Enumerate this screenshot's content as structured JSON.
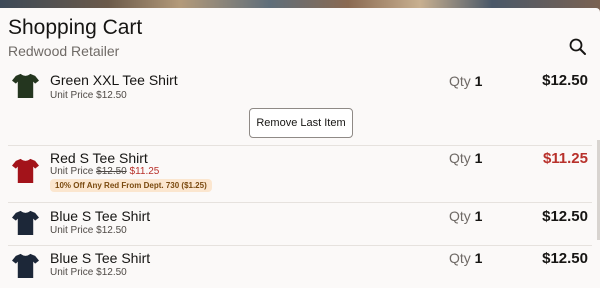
{
  "header": {
    "title": "Shopping Cart",
    "subtitle": "Redwood Retailer"
  },
  "icons": {
    "search": "search-icon",
    "product": "tshirt-icon"
  },
  "actions": {
    "remove_last_item": "Remove Last Item"
  },
  "items": [
    {
      "name": "Green XXL Tee Shirt",
      "unit_price_label": "Unit Price",
      "unit_price": "$12.50",
      "qty_label": "Qty",
      "qty": "1",
      "price": "$12.50",
      "color": "#24361f"
    },
    {
      "name": "Red S Tee Shirt",
      "unit_price_label": "Unit Price",
      "unit_price": "$12.50",
      "sale_price": "$11.25",
      "discount": "10% Off Any Red From Dept. 730 ($1.25)",
      "qty_label": "Qty",
      "qty": "1",
      "price": "$11.25",
      "color": "#a3131a"
    },
    {
      "name": "Blue S Tee Shirt",
      "unit_price_label": "Unit Price",
      "unit_price": "$12.50",
      "qty_label": "Qty",
      "qty": "1",
      "price": "$12.50",
      "color": "#1c2738"
    },
    {
      "name": "Blue S Tee Shirt",
      "unit_price_label": "Unit Price",
      "unit_price": "$12.50",
      "qty_label": "Qty",
      "qty": "1",
      "price": "$12.50",
      "color": "#1c2738"
    }
  ],
  "colors": {
    "sale": "#b8312b",
    "text": "#161513",
    "muted": "#6f6a66",
    "badge_bg": "#fbe6cf"
  }
}
